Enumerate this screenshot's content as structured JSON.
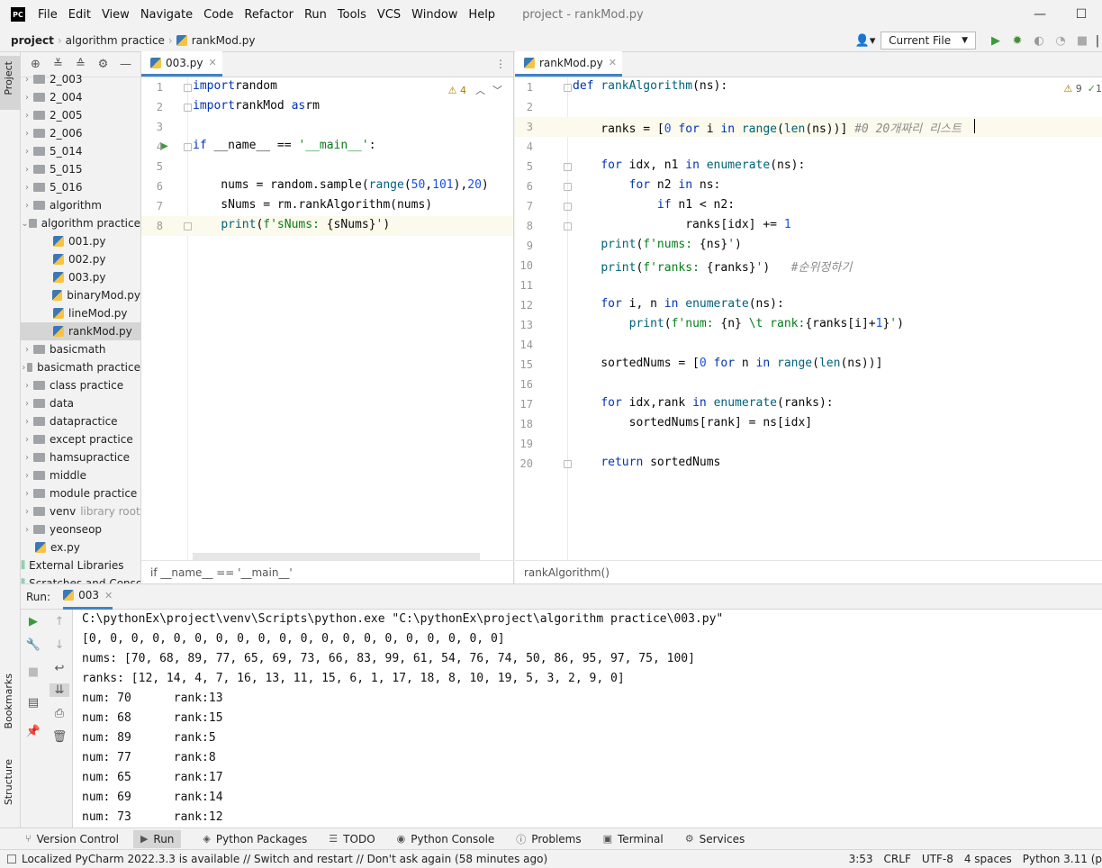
{
  "titlebar": {
    "menu": [
      "File",
      "Edit",
      "View",
      "Navigate",
      "Code",
      "Refactor",
      "Run",
      "Tools",
      "VCS",
      "Window",
      "Help"
    ],
    "window_title": "project - rankMod.py",
    "logo": "PC"
  },
  "navbar": {
    "crumbs": [
      "project",
      "algorithm practice",
      "rankMod.py"
    ],
    "run_config": "Current File"
  },
  "left_strip": {
    "project": "Project",
    "bookmarks": "Bookmarks",
    "structure": "Structure"
  },
  "tree": [
    {
      "label": "2_003",
      "type": "folder",
      "depth": 1
    },
    {
      "label": "2_004",
      "type": "folder",
      "depth": 1
    },
    {
      "label": "2_005",
      "type": "folder",
      "depth": 1
    },
    {
      "label": "2_006",
      "type": "folder",
      "depth": 1
    },
    {
      "label": "5_014",
      "type": "folder",
      "depth": 1
    },
    {
      "label": "5_015",
      "type": "folder",
      "depth": 1
    },
    {
      "label": "5_016",
      "type": "folder",
      "depth": 1
    },
    {
      "label": "algorithm",
      "type": "folder",
      "depth": 1
    },
    {
      "label": "algorithm practice",
      "type": "folder",
      "depth": 1,
      "open": true
    },
    {
      "label": "001.py",
      "type": "py",
      "depth": 2
    },
    {
      "label": "002.py",
      "type": "py",
      "depth": 2
    },
    {
      "label": "003.py",
      "type": "py",
      "depth": 2
    },
    {
      "label": "binaryMod.py",
      "type": "py",
      "depth": 2
    },
    {
      "label": "lineMod.py",
      "type": "py",
      "depth": 2
    },
    {
      "label": "rankMod.py",
      "type": "py",
      "depth": 2,
      "selected": true
    },
    {
      "label": "basicmath",
      "type": "folder",
      "depth": 1
    },
    {
      "label": "basicmath practice",
      "type": "folder",
      "depth": 1
    },
    {
      "label": "class practice",
      "type": "folder",
      "depth": 1
    },
    {
      "label": "data",
      "type": "folder",
      "depth": 1
    },
    {
      "label": "datapractice",
      "type": "folder",
      "depth": 1
    },
    {
      "label": "except practice",
      "type": "folder",
      "depth": 1
    },
    {
      "label": "hamsupractice",
      "type": "folder",
      "depth": 1
    },
    {
      "label": "middle",
      "type": "folder",
      "depth": 1
    },
    {
      "label": "module practice",
      "type": "folder",
      "depth": 1
    },
    {
      "label": "venv",
      "type": "folder",
      "depth": 1,
      "suffix": "library root"
    },
    {
      "label": "yeonseop",
      "type": "folder",
      "depth": 1
    },
    {
      "label": "ex.py",
      "type": "py",
      "depth": 1,
      "nochev": true
    },
    {
      "label": "External Libraries",
      "type": "ext",
      "depth": 0
    },
    {
      "label": "Scratches and Consoles",
      "type": "ext",
      "depth": 0
    }
  ],
  "editor1": {
    "tab": "003.py",
    "warnings": "4",
    "breadcrumb": "if __name__ == '__main__'",
    "lines": [
      [
        [
          "kw",
          "import"
        ],
        [
          "",
          "random"
        ]
      ],
      [
        [
          "kw",
          "import"
        ],
        [
          "",
          "rankMod "
        ],
        [
          "kw",
          "as"
        ],
        [
          "",
          "rm"
        ]
      ],
      [],
      [
        [
          "kw",
          "if"
        ],
        [
          "",
          " __name__ == "
        ],
        [
          "str",
          "'__main__'"
        ],
        [
          "",
          ":"
        ]
      ],
      [],
      [
        [
          "",
          "    nums = random.sample("
        ],
        [
          "fn",
          "range"
        ],
        [
          "",
          "("
        ],
        [
          "num",
          "50"
        ],
        [
          "",
          ","
        ],
        [
          "num",
          "101"
        ],
        [
          "",
          "),"
        ],
        [
          "num",
          "20"
        ],
        [
          "",
          ")"
        ]
      ],
      [
        [
          "",
          "    sNums = rm.rankAlgorithm(nums)"
        ]
      ],
      [
        [
          "",
          "    "
        ],
        [
          "fn",
          "print"
        ],
        [
          "",
          "("
        ],
        [
          "str",
          "f'sNums: "
        ],
        [
          "",
          "{sNums}"
        ],
        [
          "str",
          "'"
        ],
        [
          "",
          ")"
        ]
      ]
    ]
  },
  "editor2": {
    "tab": "rankMod.py",
    "warnings": "9",
    "checks": "1",
    "breadcrumb": "rankAlgorithm()",
    "lines": [
      [
        [
          "kw",
          "def"
        ],
        [
          "",
          " "
        ],
        [
          "fn",
          "rankAlgorithm"
        ],
        [
          "",
          "(ns):"
        ]
      ],
      [],
      [
        [
          "",
          "    ranks = ["
        ],
        [
          "num",
          "0"
        ],
        [
          "",
          " "
        ],
        [
          "kw",
          "for"
        ],
        [
          "",
          " i "
        ],
        [
          "kw",
          "in"
        ],
        [
          "",
          " "
        ],
        [
          "fn",
          "range"
        ],
        [
          "",
          "("
        ],
        [
          "fn",
          "len"
        ],
        [
          "",
          "(ns))] "
        ],
        [
          "cm",
          "#0 20개짜리 리스트"
        ]
      ],
      [],
      [
        [
          "",
          "    "
        ],
        [
          "kw",
          "for"
        ],
        [
          "",
          " idx, n1 "
        ],
        [
          "kw",
          "in"
        ],
        [
          "",
          " "
        ],
        [
          "fn",
          "enumerate"
        ],
        [
          "",
          "(ns):"
        ]
      ],
      [
        [
          "",
          "        "
        ],
        [
          "kw",
          "for"
        ],
        [
          "",
          " n2 "
        ],
        [
          "kw",
          "in"
        ],
        [
          "",
          " ns:"
        ]
      ],
      [
        [
          "",
          "            "
        ],
        [
          "kw",
          "if"
        ],
        [
          "",
          " n1 < n2:"
        ]
      ],
      [
        [
          "",
          "                ranks[idx] += "
        ],
        [
          "num",
          "1"
        ]
      ],
      [
        [
          "",
          "    "
        ],
        [
          "fn",
          "print"
        ],
        [
          "",
          "("
        ],
        [
          "str",
          "f'nums: "
        ],
        [
          "",
          "{ns}"
        ],
        [
          "str",
          "'"
        ],
        [
          "",
          ")"
        ]
      ],
      [
        [
          "",
          "    "
        ],
        [
          "fn",
          "print"
        ],
        [
          "",
          "("
        ],
        [
          "str",
          "f'ranks: "
        ],
        [
          "",
          "{ranks}"
        ],
        [
          "str",
          "'"
        ],
        [
          "",
          ")   "
        ],
        [
          "cm",
          "#순위정하기"
        ]
      ],
      [],
      [
        [
          "",
          "    "
        ],
        [
          "kw",
          "for"
        ],
        [
          "",
          " i, n "
        ],
        [
          "kw",
          "in"
        ],
        [
          "",
          " "
        ],
        [
          "fn",
          "enumerate"
        ],
        [
          "",
          "(ns):"
        ]
      ],
      [
        [
          "",
          "        "
        ],
        [
          "fn",
          "print"
        ],
        [
          "",
          "("
        ],
        [
          "str",
          "f'num: "
        ],
        [
          "",
          "{n}"
        ],
        [
          "str",
          " \\t rank:"
        ],
        [
          "",
          "{ranks[i]+"
        ],
        [
          "num",
          "1"
        ],
        [
          "",
          "}"
        ],
        [
          "str",
          "'"
        ],
        [
          "",
          ")"
        ]
      ],
      [],
      [
        [
          "",
          "    sortedNums = ["
        ],
        [
          "num",
          "0"
        ],
        [
          "",
          " "
        ],
        [
          "kw",
          "for"
        ],
        [
          "",
          " n "
        ],
        [
          "kw",
          "in"
        ],
        [
          "",
          " "
        ],
        [
          "fn",
          "range"
        ],
        [
          "",
          "("
        ],
        [
          "fn",
          "len"
        ],
        [
          "",
          "(ns))]"
        ]
      ],
      [],
      [
        [
          "",
          "    "
        ],
        [
          "kw",
          "for"
        ],
        [
          "",
          " idx,rank "
        ],
        [
          "kw",
          "in"
        ],
        [
          "",
          " "
        ],
        [
          "fn",
          "enumerate"
        ],
        [
          "",
          "(ranks):"
        ]
      ],
      [
        [
          "",
          "        sortedNums[rank] = ns[idx]"
        ]
      ],
      [],
      [
        [
          "",
          "    "
        ],
        [
          "kw",
          "return"
        ],
        [
          "",
          " sortedNums"
        ]
      ]
    ]
  },
  "run": {
    "label": "Run:",
    "tab": "003",
    "console": [
      "C:\\pythonEx\\project\\venv\\Scripts\\python.exe \"C:\\pythonEx\\project\\algorithm practice\\003.py\"",
      "[0, 0, 0, 0, 0, 0, 0, 0, 0, 0, 0, 0, 0, 0, 0, 0, 0, 0, 0, 0]",
      "nums: [70, 68, 89, 77, 65, 69, 73, 66, 83, 99, 61, 54, 76, 74, 50, 86, 95, 97, 75, 100]",
      "ranks: [12, 14, 4, 7, 16, 13, 11, 15, 6, 1, 17, 18, 8, 10, 19, 5, 3, 2, 9, 0]",
      "num: 70      rank:13",
      "num: 68      rank:15",
      "num: 89      rank:5",
      "num: 77      rank:8",
      "num: 65      rank:17",
      "num: 69      rank:14",
      "num: 73      rank:12"
    ]
  },
  "bottom_tools": [
    "Version Control",
    "Run",
    "Python Packages",
    "TODO",
    "Python Console",
    "Problems",
    "Terminal",
    "Services"
  ],
  "status": {
    "message": "Localized PyCharm 2022.3.3 is available // Switch and restart // Don't ask again (58 minutes ago)",
    "position": "3:53",
    "line_sep": "CRLF",
    "encoding": "UTF-8",
    "indent": "4 spaces",
    "interpreter": "Python 3.11 (p"
  },
  "colors": {
    "accent": "#4083c9",
    "keyword": "#0033b3",
    "string": "#067d17",
    "number": "#1750eb",
    "function": "#00627a",
    "comment": "#8c8c8c"
  }
}
